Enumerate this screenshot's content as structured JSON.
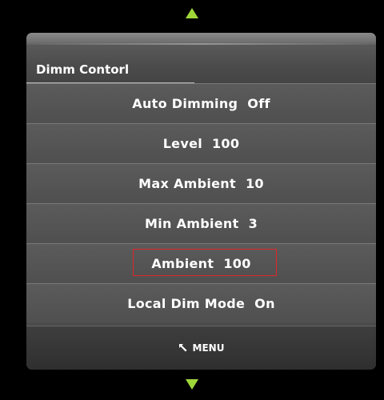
{
  "title": "Dimm Contorl",
  "items": [
    {
      "label": "Auto Dimming",
      "value": "Off"
    },
    {
      "label": "Level",
      "value": "100"
    },
    {
      "label": "Max Ambient",
      "value": "10"
    },
    {
      "label": "Min Ambient",
      "value": "3"
    },
    {
      "label": "Ambient",
      "value": "100",
      "selected": true
    },
    {
      "label": "Local Dim Mode",
      "value": "On"
    }
  ],
  "footer": {
    "label": "MENU",
    "icon": "return-arrow-icon"
  },
  "nav": {
    "up_icon": "arrow-up-icon",
    "down_icon": "arrow-down-icon"
  },
  "colors": {
    "arrow": "#9fd63a",
    "selection_border": "#e0262a",
    "background": "#000000"
  }
}
